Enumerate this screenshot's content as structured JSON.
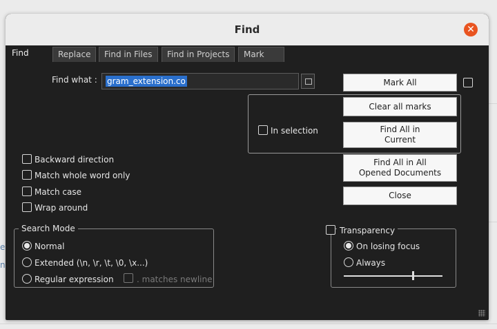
{
  "background": {
    "hint_a": "e",
    "hint_b": "n"
  },
  "dialog": {
    "title": "Find",
    "close_glyph": "✕",
    "tabs": [
      "Find",
      "Replace",
      "Find in Files",
      "Find in Projects",
      "Mark"
    ],
    "find_what_label": "Find what :",
    "find_what_value": "gram_extension.co",
    "buttons": {
      "mark_all": "Mark All",
      "clear_all_marks": "Clear all marks",
      "find_all_in_current": "Find All in\nCurrent",
      "find_all_in_all_opened": "Find All in All\nOpened Documents",
      "close": "Close"
    },
    "in_selection_label": "In selection",
    "options": {
      "backward_direction": "Backward direction",
      "match_whole_word": "Match whole word only",
      "match_case": "Match case",
      "wrap_around": "Wrap around"
    },
    "search_mode": {
      "title": "Search Mode",
      "normal": "Normal",
      "extended": "Extended (\\n, \\r, \\t, \\0, \\x...)",
      "regex": "Regular expression",
      "matches_newline": ". matches newline",
      "selected": "Normal"
    },
    "transparency": {
      "title": "Transparency",
      "on_losing_focus": "On losing focus",
      "always": "Always",
      "slider_level": 0.7
    }
  },
  "colors": {
    "accent": "#e95420",
    "selection": "#2a6fcc",
    "dialog_bg": "#1f1f1f"
  }
}
